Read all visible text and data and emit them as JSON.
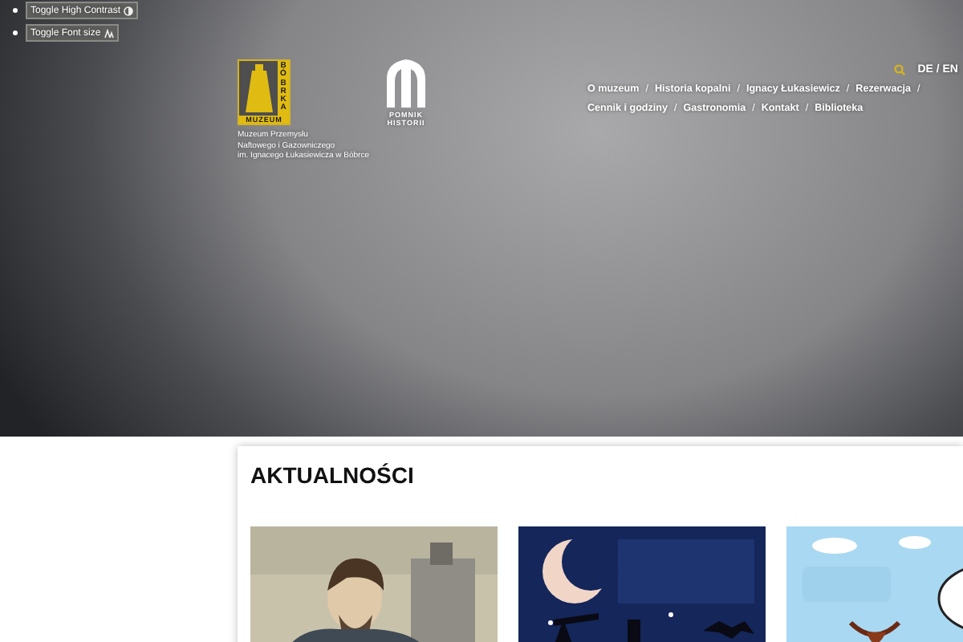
{
  "accessibility": [
    {
      "label": "Toggle High Contrast",
      "kind": "contrast"
    },
    {
      "label": "Toggle Font size",
      "kind": "font"
    }
  ],
  "logo": {
    "vertical_text": "BÓBRKA",
    "bottom_text": "MUZEUM",
    "caption": [
      "Muzeum Przemysłu",
      "Naftowego i Gazowniczego",
      "im. Ignacego Łukasiewicza w Bóbrce"
    ]
  },
  "heritage_logo": {
    "caption": [
      "POMNIK",
      "HISTORII"
    ]
  },
  "languages": "DE / EN",
  "nav": [
    [
      {
        "label": "O muzeum",
        "separator": "/"
      },
      {
        "label": "Historia kopalni",
        "separator": "/"
      },
      {
        "label": "Ignacy Łukasiewicz",
        "separator": "/"
      },
      {
        "label": "Rezerwacja",
        "separator": "/"
      }
    ],
    [
      {
        "label": "Cennik i godziny",
        "separator": "/"
      },
      {
        "label": "Gastronomia",
        "separator": "/"
      },
      {
        "label": "Kontakt",
        "separator": "/"
      },
      {
        "label": "Biblioteka"
      }
    ]
  ],
  "news": {
    "title": "AKTUALNOŚCI"
  }
}
